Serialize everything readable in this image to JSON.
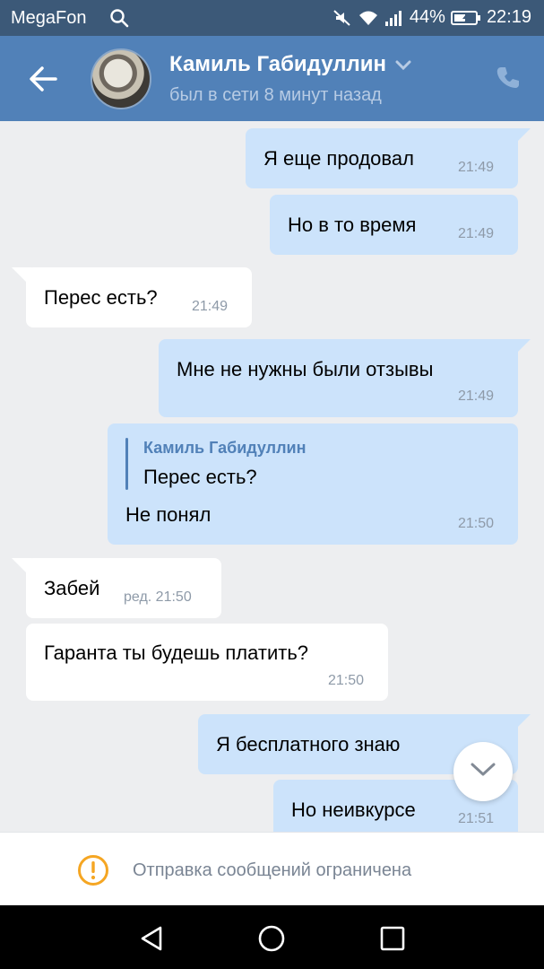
{
  "statusbar": {
    "carrier": "MegaFon",
    "battery": "44%",
    "time": "22:19",
    "icons": [
      "search-icon",
      "mute-icon",
      "wifi-icon",
      "signal-icon",
      "battery-charging-icon"
    ]
  },
  "header": {
    "contact_name": "Камиль Габидуллин",
    "status": "был в сети 8 минут назад",
    "icons": [
      "back-arrow-icon",
      "chevron-down-icon",
      "phone-icon"
    ]
  },
  "messages": [
    {
      "dir": "out",
      "text": "Я еще продовал",
      "time": "21:49"
    },
    {
      "dir": "out",
      "text": "Но в то время",
      "time": "21:49"
    },
    {
      "dir": "in",
      "text": "Перес есть?",
      "time": "21:49"
    },
    {
      "dir": "out",
      "text": "Мне не нужны были отзывы",
      "time": "21:49"
    },
    {
      "dir": "out",
      "quote_author": "Камиль Габидуллин",
      "quote_text": "Перес есть?",
      "text": "Не понял",
      "time": "21:50"
    },
    {
      "dir": "in",
      "text": "Забей",
      "time": "ред. 21:50"
    },
    {
      "dir": "in",
      "text": "Гаранта ты будешь платить?",
      "time": "21:50"
    },
    {
      "dir": "out",
      "text": "Я бесплатного знаю",
      "time": ""
    },
    {
      "dir": "out",
      "text": "Но неивкурсе",
      "time": "21:51"
    }
  ],
  "restriction": {
    "text": "Отправка сообщений ограничена",
    "icon": "warning-icon",
    "icon_color": "#f5a623"
  },
  "colors": {
    "statusbar": "#3c5978",
    "header": "#5181b8",
    "background": "#edeef0",
    "outgoing_bubble": "#cce3fb",
    "incoming_bubble": "#ffffff"
  }
}
